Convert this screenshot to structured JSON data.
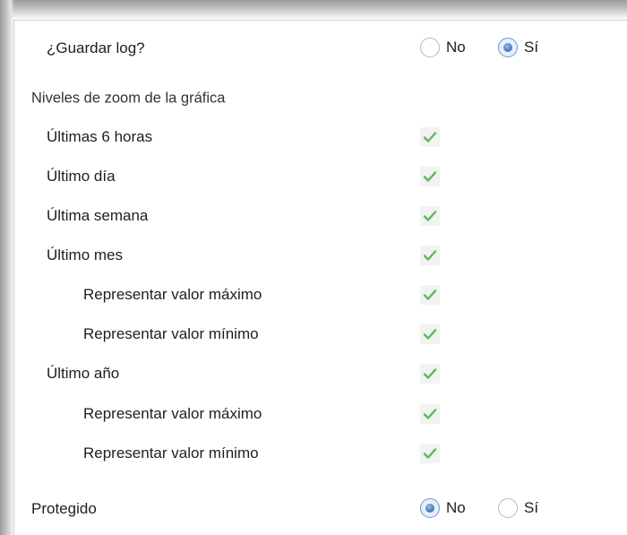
{
  "settings": {
    "save_log": {
      "label": "¿Guardar log?",
      "options": [
        {
          "label": "No",
          "checked": false
        },
        {
          "label": "Sí",
          "checked": true
        }
      ]
    },
    "zoom_section": {
      "title": "Niveles de zoom de la gráfica",
      "items": [
        {
          "label": "Últimas 6 horas",
          "checked": true
        },
        {
          "label": "Último día",
          "checked": true
        },
        {
          "label": "Última semana",
          "checked": true
        },
        {
          "label": "Último mes",
          "checked": true
        },
        {
          "label": "Representar valor máximo",
          "checked": true
        },
        {
          "label": "Representar valor mínimo",
          "checked": true
        },
        {
          "label": "Último año",
          "checked": true
        },
        {
          "label": "Representar valor máximo",
          "checked": true
        },
        {
          "label": "Representar valor mínimo",
          "checked": true
        }
      ]
    },
    "protected": {
      "label": "Protegido",
      "options": [
        {
          "label": "No",
          "checked": true
        },
        {
          "label": "Sí",
          "checked": false
        }
      ]
    }
  },
  "colors": {
    "checkmark": "#5cb85c",
    "checkbox_bg": "#f2f2f2",
    "radio_selected": "#4f7fc0"
  },
  "icons": {
    "checkmark": "check-icon",
    "radio_selected": "radio-selected-icon",
    "radio_empty": "radio-empty-icon"
  }
}
